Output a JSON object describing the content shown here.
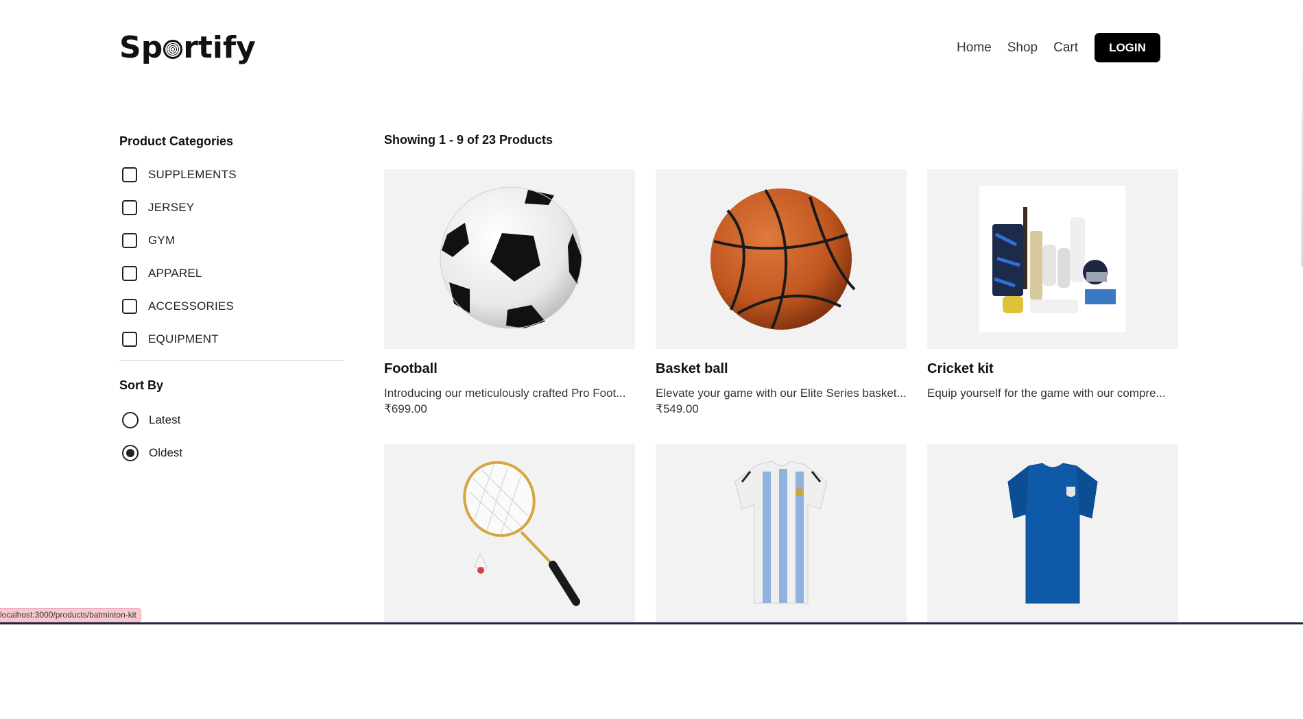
{
  "brand": {
    "name_prefix": "Sp",
    "name_suffix": "rtify"
  },
  "nav": {
    "home": "Home",
    "shop": "Shop",
    "cart": "Cart",
    "login": "LOGIN"
  },
  "sidebar": {
    "categories_title": "Product Categories",
    "categories": [
      "SUPPLEMENTS",
      "JERSEY",
      "GYM",
      "APPAREL",
      "ACCESSORIES",
      "EQUIPMENT"
    ],
    "sort_title": "Sort By",
    "sort_options": [
      {
        "label": "Latest",
        "selected": false
      },
      {
        "label": "Oldest",
        "selected": true
      }
    ]
  },
  "main": {
    "showing": "Showing 1 - 9 of 23 Products",
    "products": [
      {
        "title": "Football",
        "desc": "Introducing our meticulously crafted Pro Foot...",
        "price": "₹699.00",
        "image": "football-image"
      },
      {
        "title": "Basket ball",
        "desc": "Elevate your game with our Elite Series basket...",
        "price": "₹549.00",
        "image": "basketball-image"
      },
      {
        "title": "Cricket kit",
        "desc": "Equip yourself for the game with our compre...",
        "price": "",
        "image": "cricket-kit-image"
      },
      {
        "title": "",
        "desc": "",
        "price": "",
        "image": "badminton-racket-image"
      },
      {
        "title": "",
        "desc": "",
        "price": "",
        "image": "argentina-jersey-image"
      },
      {
        "title": "",
        "desc": "",
        "price": "",
        "image": "blue-tshirt-image"
      }
    ]
  },
  "status_bar": {
    "url": "localhost:3000/products/batminton-kit"
  },
  "colors": {
    "accent": "#000000",
    "card_bg": "#f2f2f2",
    "status_bg": "#f9c8d0"
  }
}
